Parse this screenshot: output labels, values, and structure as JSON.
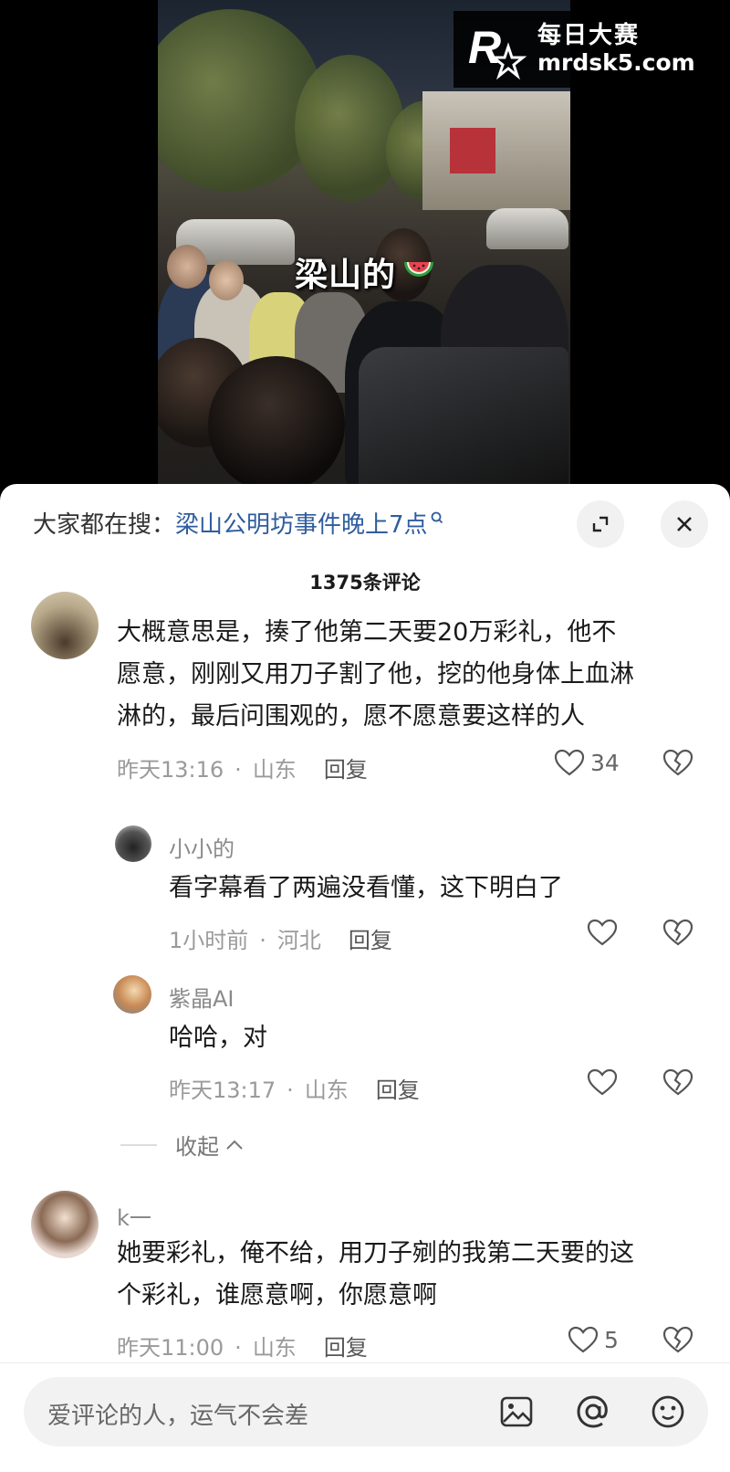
{
  "video": {
    "caption": "梁山的",
    "watermark_title": "每日大赛",
    "watermark_url": "mrdsk5.com",
    "watermark_logo_text": "R"
  },
  "header": {
    "search_prefix": "大家都在搜：",
    "search_keyword": "梁山公明坊事件晚上7点",
    "comment_count": "1375条评论"
  },
  "comments": [
    {
      "text_lines": [
        "大概意思是，揍了他第二天要20万彩礼，他不",
        "愿意，刚刚又用刀子割了他，挖的他身体上血淋",
        "淋的，最后问围观的，愿不愿意要这样的人"
      ],
      "time": "昨天13:16",
      "location": "山东",
      "reply_label": "回复",
      "likes": "34"
    },
    {
      "author": "小小的",
      "text": "看字幕看了两遍没看懂，这下明白了",
      "time": "1小时前",
      "location": "河北",
      "reply_label": "回复"
    },
    {
      "author": "紫晶AI",
      "text": "哈哈，对",
      "time": "昨天13:17",
      "location": "山东",
      "reply_label": "回复"
    },
    {
      "author": "k一",
      "text_lines": [
        "她要彩礼，俺不给，用刀子剜的我第二天要的这",
        "个彩礼，谁愿意啊，你愿意啊"
      ],
      "time": "昨天11:00",
      "location": "山东",
      "reply_label": "回复",
      "likes": "5"
    }
  ],
  "collapse_label": "收起",
  "input": {
    "placeholder": "爱评论的人，运气不会差"
  },
  "icons": {
    "expand": "expand-icon",
    "close": "close-icon",
    "like": "heart-icon",
    "dislike": "broken-heart-icon",
    "image": "image-icon",
    "mention": "at-icon",
    "emoji": "emoji-icon"
  }
}
